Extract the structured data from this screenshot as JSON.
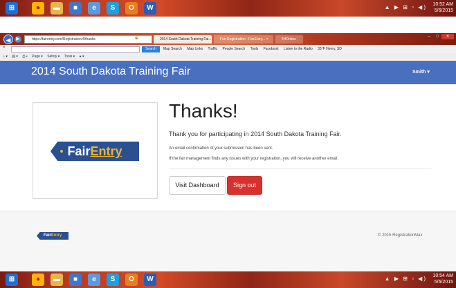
{
  "taskbar": {
    "clock_time": "10:52 AM",
    "clock_date": "5/6/2015",
    "clock_time_bottom": "10:54 AM",
    "clock_date_bottom": "5/6/2015",
    "tray_icons": "▲ ▶ ⊞ ▫ ◀)"
  },
  "browser": {
    "url": "https://fairentry.com/Registration/4/thanks",
    "address_icons": "ρ ▾ 🔒 C",
    "tabs": [
      {
        "label": "2014 South Dakota Training Fai..."
      },
      {
        "label": "Fair Registration - FairEntry...  ×"
      },
      {
        "label": "4HOnline"
      }
    ],
    "search_button": "Search",
    "favorites": [
      "Map Search",
      "Map Links",
      "Traffic",
      "People Search",
      "Tools",
      "Facebook",
      "Listen to the Radio",
      "33°F Henry, SD"
    ],
    "command_bar": [
      "Page ▾",
      "Safety ▾",
      "Tools ▾"
    ]
  },
  "header": {
    "app_title": "2014 South Dakota Training Fair",
    "user_menu": "Smith ▾"
  },
  "logo": {
    "fair": "Fair",
    "entry": "Entry"
  },
  "main": {
    "heading": "Thanks!",
    "thank_you": "Thank you for participating in 2014 South Dakota Training Fair.",
    "email_note": "An email confirmation of your submission has been sent.",
    "issue_note": "If the fair management finds any issues with your registration, you will receive another email.",
    "visit_dashboard": "Visit Dashboard",
    "sign_out": "Sign out"
  },
  "footer": {
    "logo_fair": "Fair",
    "logo_entry": "Entry",
    "copyright": "© 2015 RegistrationMax"
  },
  "colors": {
    "header_blue": "#4a6fbf",
    "sign_out_red": "#d9302e",
    "fairentry_blue": "#2a5092",
    "fairentry_gold": "#f2b32a"
  }
}
